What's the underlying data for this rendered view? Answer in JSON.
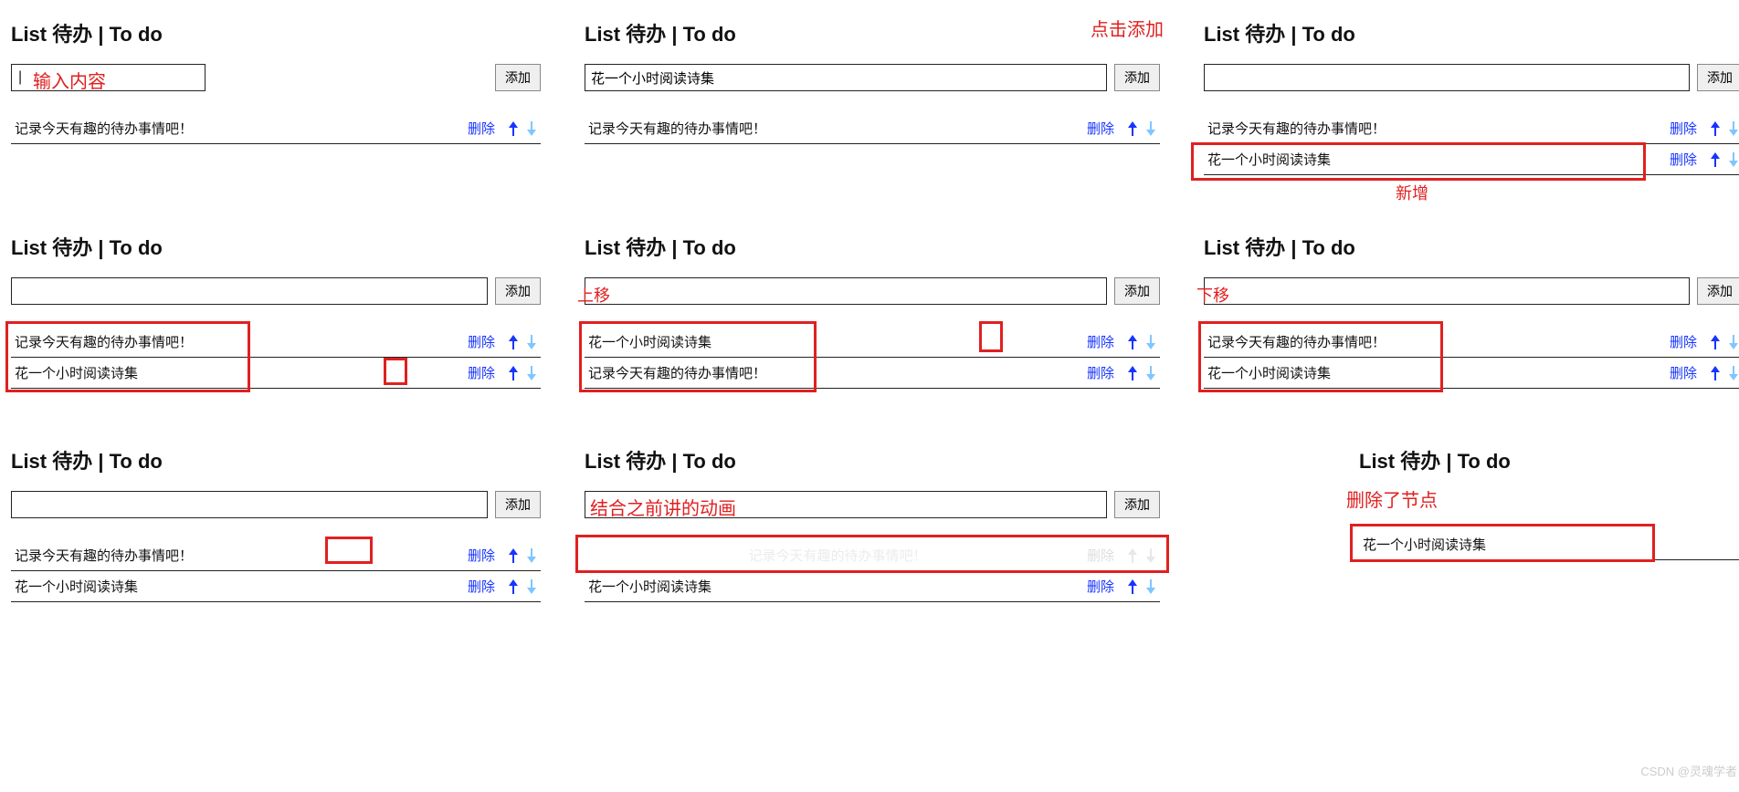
{
  "title": "List 待办 | To do",
  "add_label": "添加",
  "delete_label": "删除",
  "item1_text": "记录今天有趣的待办事情吧！",
  "item2_text": "花一个小时阅读诗集",
  "p1": {
    "input_anno": "输入内容",
    "caret": "|"
  },
  "p2": {
    "input_value": "花一个小时阅读诗集",
    "right_anno": "点击添加"
  },
  "p3": {
    "mid_anno": "新增"
  },
  "p5": {
    "anno": "上移"
  },
  "p6": {
    "anno": "下移"
  },
  "p8": {
    "anno": "结合之前讲的动画"
  },
  "p9": {
    "anno": "删除了节点"
  },
  "watermark": "CSDN @灵魂学者"
}
